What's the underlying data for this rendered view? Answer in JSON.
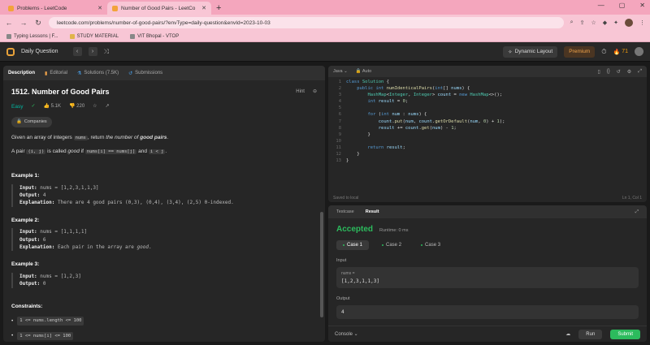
{
  "browser": {
    "tabs": [
      {
        "title": "Problems - LeetCode",
        "active": false
      },
      {
        "title": "Number of Good Pairs - LeetCo",
        "active": true
      }
    ],
    "url": "leetcode.com/problems/number-of-good-pairs/?envType=daily-question&envId=2023-10-03",
    "bookmarks": [
      "Typing Lessons | F...",
      "STUDY MATERIAL",
      "VIT Bhopal - VTOP"
    ]
  },
  "header": {
    "title": "Daily Question",
    "dynamic_layout": "Dynamic Layout",
    "premium": "Premium",
    "streak": "71"
  },
  "left_tabs": [
    "Description",
    "Editorial",
    "Solutions (7.5K)",
    "Submissions"
  ],
  "problem": {
    "title": "1512. Number of Good Pairs",
    "hint": "Hint",
    "difficulty": "Easy",
    "likes": "5.1K",
    "dislikes": "220",
    "companies": "Companies",
    "p1_a": "Given an array of integers ",
    "p1_code": "nums",
    "p1_b": ", return ",
    "p1_c": "the number of ",
    "p1_d": "good pairs",
    "p1_e": ".",
    "p2_a": "A pair ",
    "p2_code1": "(i, j)",
    "p2_b": " is called ",
    "p2_c": "good",
    "p2_d": " if ",
    "p2_code2": "nums[i] == nums[j]",
    "p2_e": " and ",
    "p2_code3": "i < j",
    "p2_f": ".",
    "examples": [
      {
        "head": "Example 1:",
        "input": " nums = [1,2,3,1,1,3]",
        "output": " 4",
        "expl": " There are 4 good pairs (0,3), (0,4), (3,4), (2,5) 0-indexed."
      },
      {
        "head": "Example 2:",
        "input": " nums = [1,1,1,1]",
        "output": " 6",
        "expl_a": " Each pair in the array are ",
        "expl_b": "good",
        "expl_c": "."
      },
      {
        "head": "Example 3:",
        "input": " nums = [1,2,3]",
        "output": " 0"
      }
    ],
    "constraints_title": "Constraints:",
    "constraint1": "1 <= nums.length <= 100",
    "constraint2": "1 <= nums[i] <= 100"
  },
  "labels": {
    "input": "Input:",
    "output": "Output:",
    "explanation": "Explanation:"
  },
  "editor": {
    "language": "Java",
    "mode": "Auto",
    "saved": "Saved to local",
    "cursor": "Ln 1, Col 1"
  },
  "result": {
    "tabs": [
      "Testcase",
      "Result"
    ],
    "status": "Accepted",
    "runtime": "Runtime: 0 ms",
    "cases": [
      "Case 1",
      "Case 2",
      "Case 3"
    ],
    "input_label": "Input",
    "var_name": "nums =",
    "input_value": "[1,2,3,1,1,3]",
    "output_label": "Output",
    "output_value": "4",
    "console": "Console",
    "run": "Run",
    "submit": "Submit"
  }
}
